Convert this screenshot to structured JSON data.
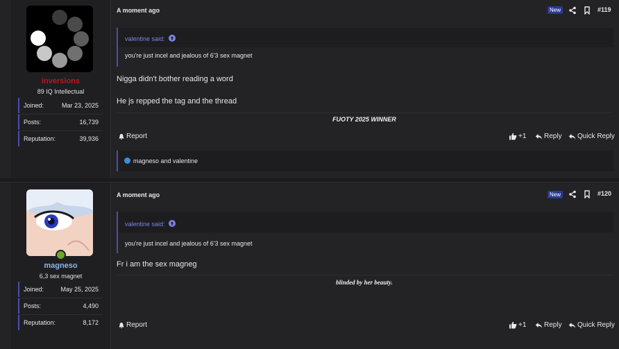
{
  "posts": [
    {
      "user": {
        "name": "inversions",
        "title": "89 IQ Intellectual",
        "name_color": "#c0141c"
      },
      "stats": [
        {
          "label": "Joined:",
          "value": "Mar 23, 2025"
        },
        {
          "label": "Posts:",
          "value": "16,739"
        },
        {
          "label": "Reputation:",
          "value": "39,936"
        }
      ],
      "time": "A moment ago",
      "badge": "New",
      "number": "#119",
      "quote": {
        "author": "valentine said:",
        "text": "you're just incel and jealous of 6'3 sex magnet"
      },
      "lines": [
        "Nigga didn't bother reading a word",
        "He js repped the tag and the thread"
      ],
      "signature": "FUOTY 2025 WINNER",
      "actions": {
        "report": "Report",
        "like_count": "+1",
        "reply": "Reply",
        "quick_reply": "Quick Reply"
      },
      "reactions": "magneso and valentine"
    },
    {
      "user": {
        "name": "magneso",
        "title": "6,3 sex magnet",
        "name_color": "#8fb6e8"
      },
      "stats": [
        {
          "label": "Joined:",
          "value": "May 25, 2025"
        },
        {
          "label": "Posts:",
          "value": "4,490"
        },
        {
          "label": "Reputation:",
          "value": "8,172"
        }
      ],
      "time": "A moment ago",
      "badge": "New",
      "number": "#120",
      "quote": {
        "author": "valentine said:",
        "text": "you're just incel and jealous of 6'3 sex magnet"
      },
      "lines": [
        "Fr i am the sex magneg"
      ],
      "signature": "blinded by her beauty.",
      "actions": {
        "report": "Report",
        "like_count": "+1",
        "reply": "Reply",
        "quick_reply": "Quick Reply"
      }
    }
  ],
  "colors": {
    "accent": "#4a4fa8",
    "quote_link": "#7c84e0",
    "badge": "#2a3a8f"
  }
}
